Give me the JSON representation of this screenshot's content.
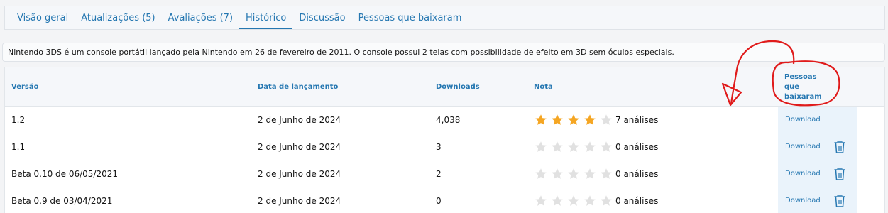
{
  "tabs": [
    {
      "label": "Visão geral"
    },
    {
      "label": "Atualizações (5)"
    },
    {
      "label": "Avaliações (7)"
    },
    {
      "label": "Histórico"
    },
    {
      "label": "Discussão"
    },
    {
      "label": "Pessoas que baixaram"
    }
  ],
  "active_tab": "Histórico",
  "description": "Nintendo 3DS é um console portátil lançado pela Nintendo em 26 de fevereiro de 2011. O console possui 2 telas com possibilidade de efeito em 3D sem óculos especiais.",
  "table": {
    "headers": {
      "version": "Versão",
      "release_date": "Data de lançamento",
      "downloads": "Downloads",
      "rating": "Nota",
      "people": "Pessoas\nque\nbaixaram"
    },
    "rows": [
      {
        "version": "1.2",
        "release_date": "2 de Junho de 2024",
        "downloads": "4,038",
        "rating": 4,
        "reviews": "7 análises",
        "download_label": "Download",
        "can_delete": false
      },
      {
        "version": "1.1",
        "release_date": "2 de Junho de 2024",
        "downloads": "3",
        "rating": 0,
        "reviews": "0 análises",
        "download_label": "Download",
        "can_delete": true
      },
      {
        "version": "Beta 0.10 de 06/05/2021",
        "release_date": "2 de Junho de 2024",
        "downloads": "2",
        "rating": 0,
        "reviews": "0 análises",
        "download_label": "Download",
        "can_delete": true
      },
      {
        "version": "Beta 0.9 de 03/04/2021",
        "release_date": "2 de Junho de 2024",
        "downloads": "0",
        "rating": 0,
        "reviews": "0 análises",
        "download_label": "Download",
        "can_delete": true
      }
    ]
  },
  "colors": {
    "link": "#2577b1",
    "star_filled": "#f5a623",
    "star_empty": "#e1e1e1",
    "annotation": "#e01b1b"
  },
  "icons": {
    "star": "star-icon",
    "trash": "trash-icon"
  }
}
